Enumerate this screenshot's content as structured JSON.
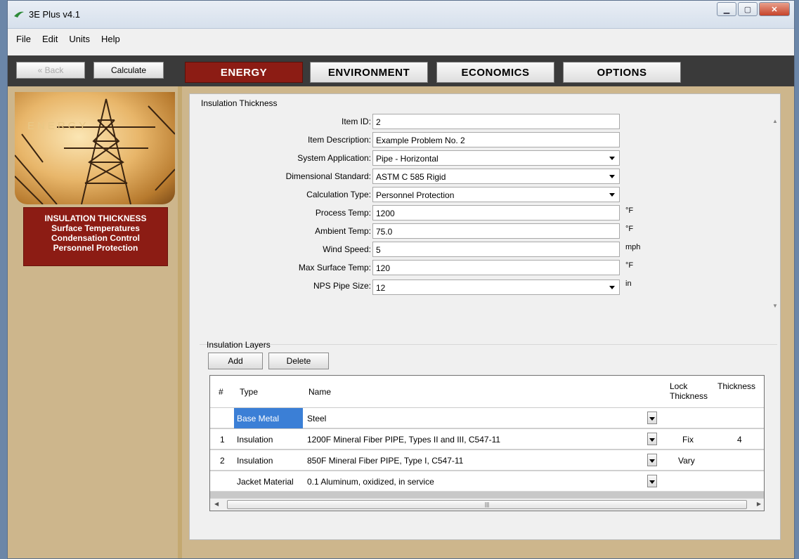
{
  "window": {
    "title": "3E Plus v4.1"
  },
  "menu": [
    "File",
    "Edit",
    "Units",
    "Help"
  ],
  "toolbar": {
    "back_label": "« Back",
    "calculate_label": "Calculate"
  },
  "tabs": [
    "ENERGY",
    "ENVIRONMENT",
    "ECONOMICS",
    "OPTIONS"
  ],
  "sidebar": {
    "image_label": "ENERGY",
    "nav": [
      "INSULATION THICKNESS",
      "Surface Temperatures",
      "Condensation Control",
      "Personnel Protection"
    ]
  },
  "insulation_thickness": {
    "title": "Insulation Thickness",
    "item_id": {
      "label": "Item ID:",
      "value": "2"
    },
    "item_description": {
      "label": "Item Description:",
      "value": "Example Problem No. 2"
    },
    "system_application": {
      "label": "System Application:",
      "value": "Pipe - Horizontal"
    },
    "dimensional_standard": {
      "label": "Dimensional Standard:",
      "value": "ASTM C 585 Rigid"
    },
    "calculation_type": {
      "label": "Calculation Type:",
      "value": "Personnel Protection"
    },
    "process_temp": {
      "label": "Process Temp:",
      "value": "1200",
      "unit": "°F"
    },
    "ambient_temp": {
      "label": "Ambient Temp:",
      "value": "75.0",
      "unit": "°F"
    },
    "wind_speed": {
      "label": "Wind Speed:",
      "value": "5",
      "unit": "mph"
    },
    "max_surface_temp": {
      "label": "Max Surface Temp:",
      "value": "120",
      "unit": "°F"
    },
    "nps_pipe_size": {
      "label": "NPS Pipe Size:",
      "value": "12",
      "unit": "in"
    }
  },
  "layers": {
    "title": "Insulation Layers",
    "add_label": "Add",
    "delete_label": "Delete",
    "headers": {
      "num": "#",
      "type": "Type",
      "name": "Name",
      "lock": "Lock Thickness",
      "thickness": "Thickness"
    },
    "rows": [
      {
        "num": "",
        "type": "Base Metal",
        "name": "Steel",
        "lock": "",
        "thickness": ""
      },
      {
        "num": "1",
        "type": "Insulation",
        "name": "1200F Mineral Fiber PIPE, Types II and III, C547-11",
        "lock": "Fix",
        "thickness": "4"
      },
      {
        "num": "2",
        "type": "Insulation",
        "name": "850F Mineral Fiber PIPE, Type I, C547-11",
        "lock": "Vary",
        "thickness": ""
      },
      {
        "num": "",
        "type": "Jacket Material",
        "name": "0.1 Aluminum, oxidized, in service",
        "lock": "",
        "thickness": ""
      }
    ]
  },
  "colors": {
    "accent": "#8c1c14",
    "sidebar_bg": "#cdb68c",
    "toolbar_bg": "#3a3a3a",
    "selected_cell": "#3b7fd6"
  }
}
